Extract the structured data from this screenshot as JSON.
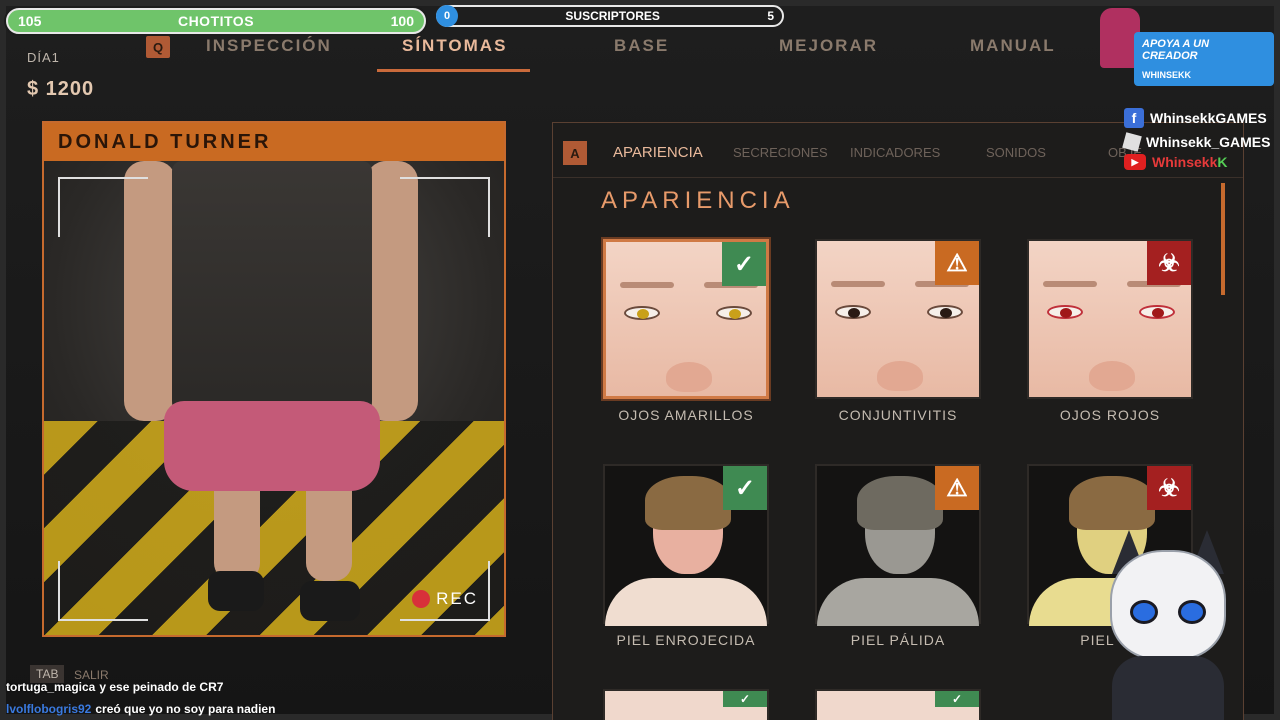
{
  "overlay": {
    "chotitos": {
      "left": "105",
      "title": "CHOTITOS",
      "right": "100"
    },
    "subs": {
      "start": "0",
      "title": "SUSCRIPTORES",
      "end": "5"
    },
    "support": {
      "line1": "APOYA A UN CREADOR",
      "line2": "WHINSEKK"
    },
    "facebook": "WhinsekkGAMES",
    "roblox": "Whinsekk_GAMES",
    "youtube": {
      "name": "Whinsekk",
      "suffix": "K"
    }
  },
  "nav": {
    "key": "Q",
    "tabs": [
      {
        "label": "INSPECCIÓN"
      },
      {
        "label": "SÍNTOMAS"
      },
      {
        "label": "BASE"
      },
      {
        "label": "MEJORAR"
      },
      {
        "label": "MANUAL"
      }
    ],
    "active": "SÍNTOMAS"
  },
  "status": {
    "day": "DÍA1",
    "money": "$ 1200"
  },
  "patient": {
    "name": "DONALD TURNER",
    "rec": "REC"
  },
  "footer": {
    "tab_key": "TAB",
    "tab_label": "SALIR"
  },
  "symptoms": {
    "key": "A",
    "subtabs": [
      "APARIENCIA",
      "SECRECIONES",
      "INDICADORES",
      "SONIDOS",
      "OBJE"
    ],
    "section_title": "APARIENCIA",
    "cards": [
      {
        "label": "OJOS AMARILLOS",
        "badge": "safe",
        "iris": "#c9a01a"
      },
      {
        "label": "CONJUNTIVITIS",
        "badge": "warn",
        "iris": "#3a1a14"
      },
      {
        "label": "OJOS ROJOS",
        "badge": "bio",
        "iris": "#a01818"
      },
      {
        "label": "PIEL ENROJECIDA",
        "badge": "safe",
        "skin": "#e8b0a0"
      },
      {
        "label": "PIEL PÁLIDA",
        "badge": "warn",
        "skin": "#9a9892"
      },
      {
        "label": "PIEL VE",
        "badge": "bio",
        "skin": "#e0d080"
      }
    ]
  },
  "chat": [
    {
      "user": "tortuga_magica",
      "msg": "y ese peinado de CR7"
    },
    {
      "user": "lvolflobogris92",
      "msg": "creó que yo no soy para nadien"
    }
  ]
}
